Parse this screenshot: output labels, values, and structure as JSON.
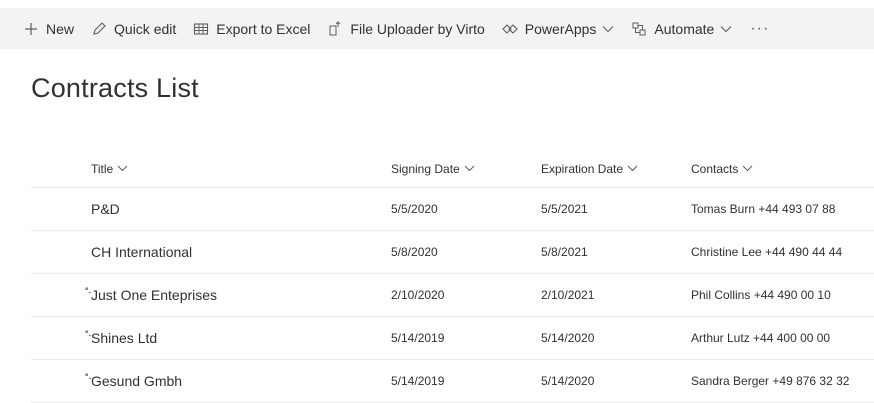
{
  "commands": {
    "new": "New",
    "quick_edit": "Quick edit",
    "export": "Export to Excel",
    "uploader": "File Uploader by Virto",
    "powerapps": "PowerApps",
    "automate": "Automate",
    "more": "···"
  },
  "page": {
    "title": "Contracts List"
  },
  "columns": {
    "title": "Title",
    "signing": "Signing Date",
    "expiration": "Expiration Date",
    "contacts": "Contacts"
  },
  "rows": [
    {
      "title": "P&D",
      "signing": "5/5/2020",
      "expiration": "5/5/2021",
      "contacts": "Tomas Burn +44 493 07 88",
      "is_new": false
    },
    {
      "title": "CH International",
      "signing": "5/8/2020",
      "expiration": "5/8/2021",
      "contacts": "Christine Lee +44 490 44 44",
      "is_new": false
    },
    {
      "title": "Just One Enteprises",
      "signing": "2/10/2020",
      "expiration": "2/10/2021",
      "contacts": "Phil Collins +44 490 00 10",
      "is_new": true
    },
    {
      "title": "Shines Ltd",
      "signing": "5/14/2019",
      "expiration": "5/14/2020",
      "contacts": "Arthur Lutz +44 400 00 00",
      "is_new": true
    },
    {
      "title": "Gesund Gmbh",
      "signing": "5/14/2019",
      "expiration": "5/14/2020",
      "contacts": "Sandra Berger +49 876 32 32",
      "is_new": true
    }
  ],
  "icons": {
    "new": "plus-icon",
    "quick_edit": "pencil-icon",
    "export": "excel-grid-icon",
    "uploader": "file-upload-icon",
    "powerapps": "powerapps-icon",
    "automate": "flow-icon",
    "sort": "chevron-down-icon",
    "new_item": "new-item-sparkle-icon"
  },
  "colors": {
    "commandbar_bg": "#f4f3f2",
    "text": "#323130",
    "icon": "#605e5c",
    "divider": "#edebe9"
  }
}
